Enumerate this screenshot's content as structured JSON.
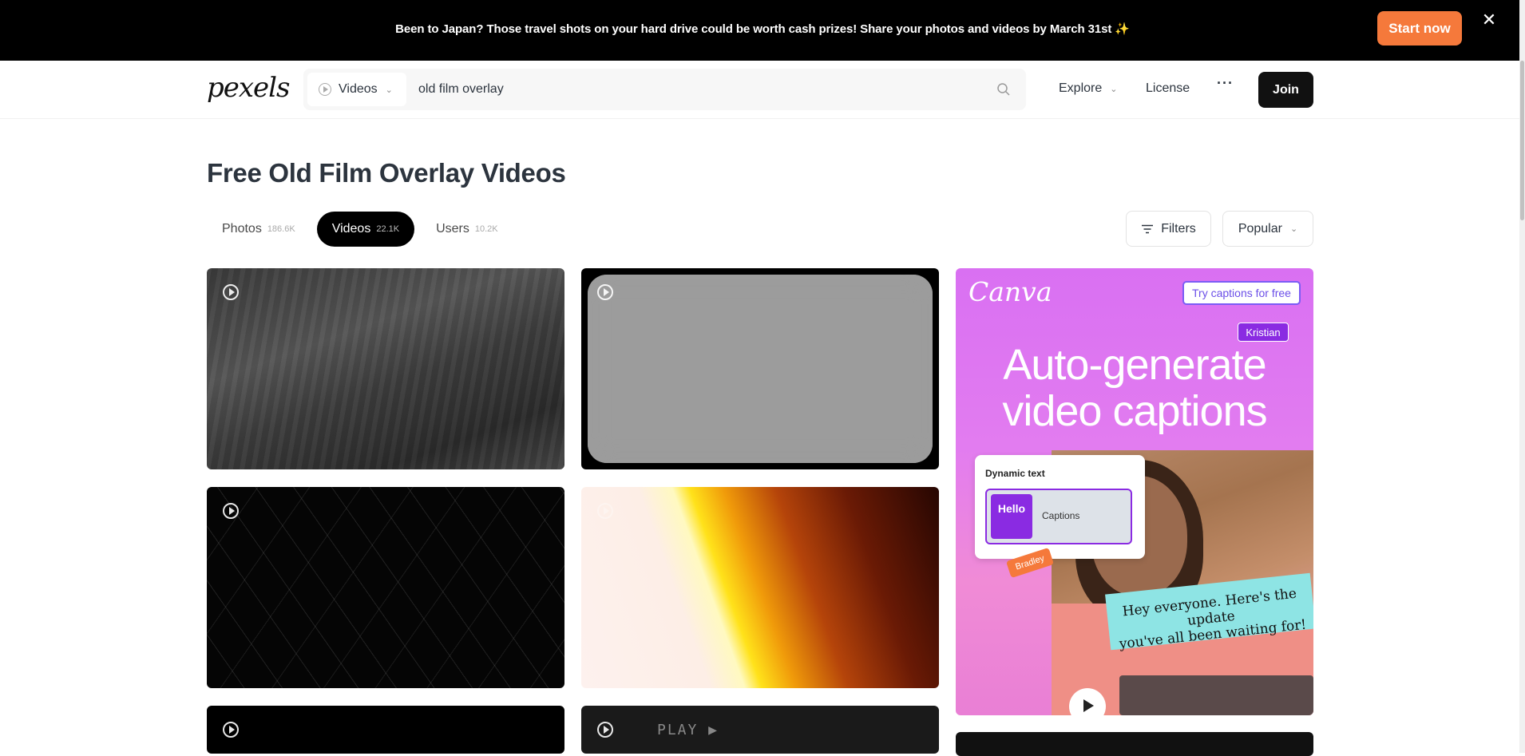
{
  "banner": {
    "text": "Been to Japan? Those travel shots on your hard drive could be worth cash prizes! Share your photos and videos by March 31st ✨",
    "cta": "Start now",
    "close": "✕"
  },
  "nav": {
    "logo": "pexels",
    "search_type": "Videos",
    "search_value": "old film overlay",
    "explore": "Explore",
    "license": "License",
    "more": "···",
    "join": "Join"
  },
  "page": {
    "title": "Free Old Film Overlay Videos"
  },
  "tabs": [
    {
      "label": "Photos",
      "count": "186.6K",
      "active": false
    },
    {
      "label": "Videos",
      "count": "22.1K",
      "active": true
    },
    {
      "label": "Users",
      "count": "10.2K",
      "active": false
    }
  ],
  "controls": {
    "filters": "Filters",
    "sort": "Popular"
  },
  "tiles": {
    "t6_text": "PLAY ▶"
  },
  "ad": {
    "logo": "Canva",
    "cta": "Try captions for free",
    "name_tag": "Kristian",
    "headline_1": "Auto-generate",
    "headline_2": "video captions",
    "card_title": "Dynamic text",
    "card_hello": "Hello",
    "card_captions": "Captions",
    "tag_bradley": "Bradley",
    "bubble_1": "Hey everyone. Here's the update",
    "bubble_2": "you've all been waiting for!"
  },
  "colors": {
    "banner_cta": "#f5793b",
    "ad_purple": "#8a2be2"
  }
}
